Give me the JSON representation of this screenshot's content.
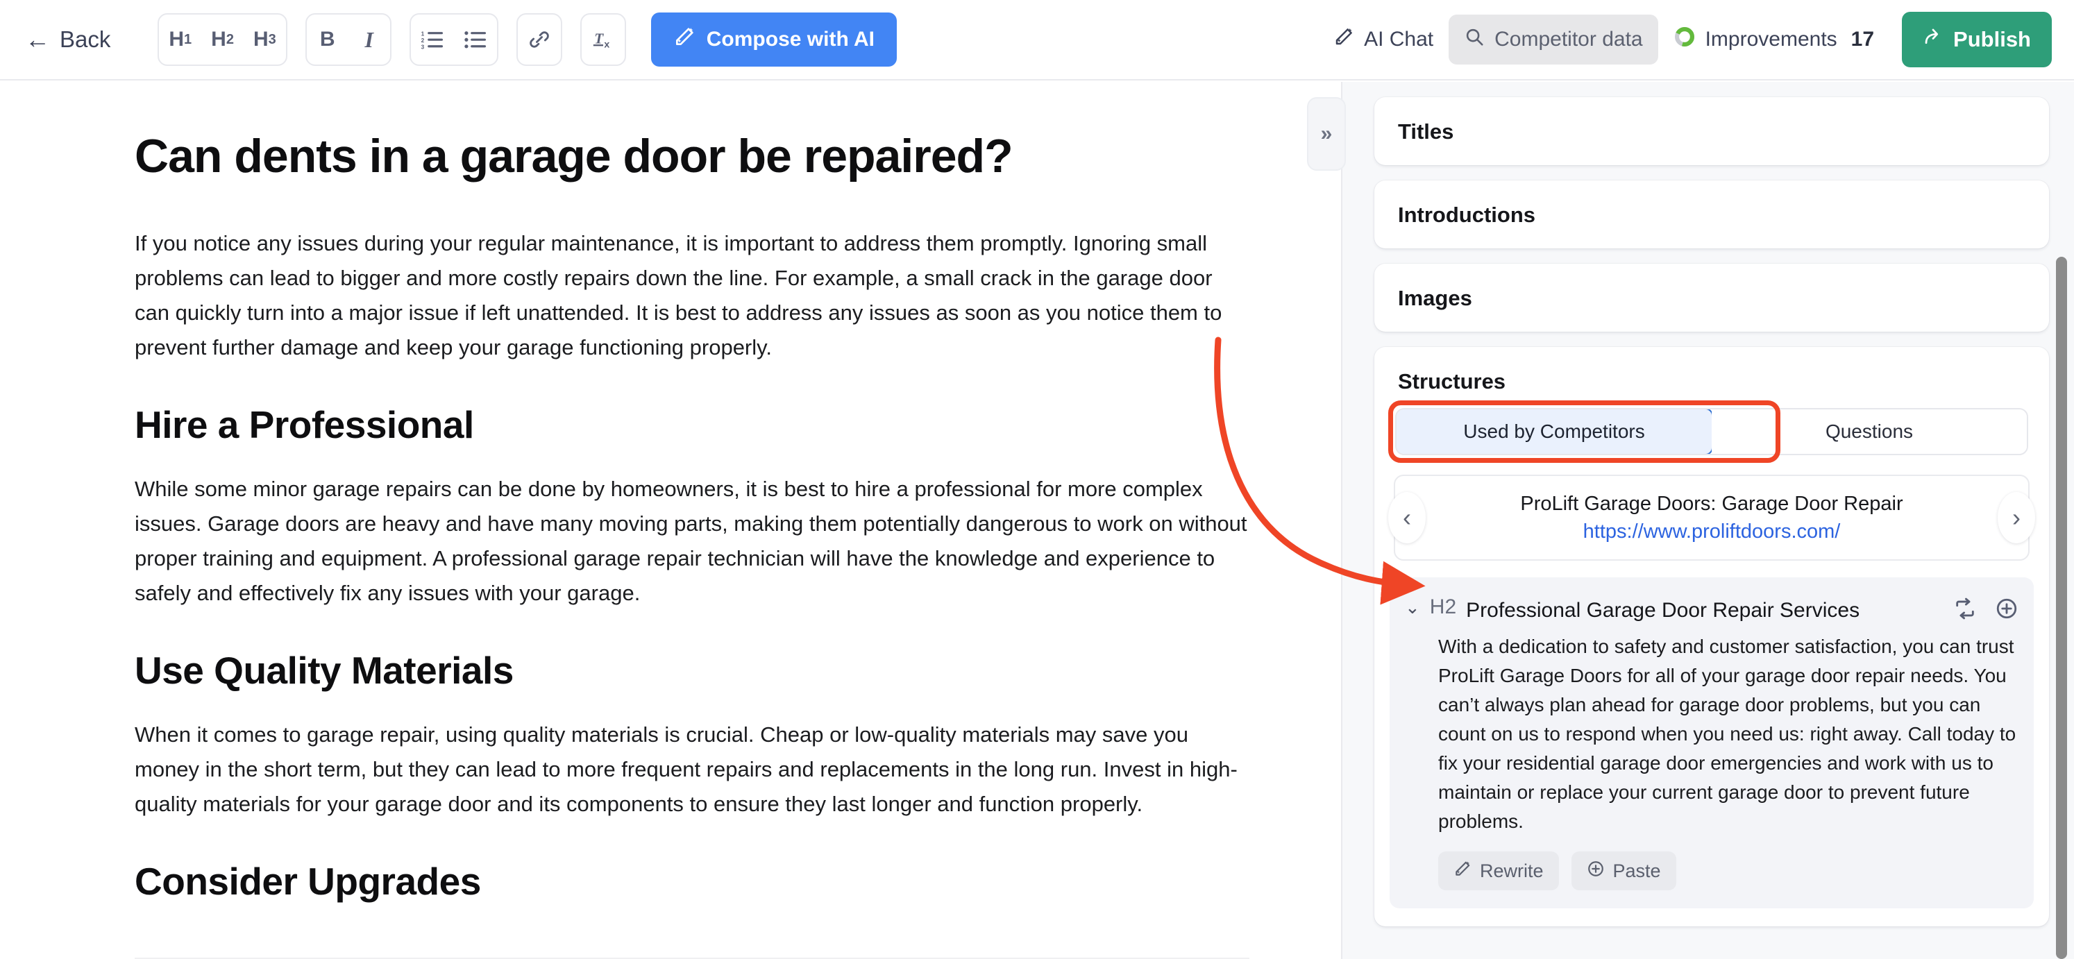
{
  "toolbar": {
    "back_label": "Back",
    "back_icon": "arrow-left-icon",
    "heading_buttons": [
      {
        "label": "H",
        "sub": "1",
        "name": "h1"
      },
      {
        "label": "H",
        "sub": "2",
        "name": "h2"
      },
      {
        "label": "H",
        "sub": "3",
        "name": "h3"
      }
    ],
    "format_buttons": [
      {
        "label": "B",
        "name": "bold"
      },
      {
        "label": "I",
        "name": "italic"
      }
    ],
    "list_buttons": [
      {
        "icon": "ordered-list-icon",
        "name": "ordered-list"
      },
      {
        "icon": "bullet-list-icon",
        "name": "bullet-list"
      }
    ],
    "link_button": {
      "icon": "link-icon",
      "name": "insert-link"
    },
    "clear_format_button": {
      "label": "Tx",
      "icon": "clear-format-icon",
      "name": "clear-formatting"
    },
    "compose_label": "Compose with AI",
    "compose_icon": "magic-wand-icon",
    "compose_color": "#4285f4",
    "ai_chat_label": "AI Chat",
    "ai_chat_icon": "magic-wand-icon",
    "competitor_data_label": "Competitor data",
    "competitor_data_icon": "search-icon",
    "improvements_label": "Improvements",
    "improvements_count": "17",
    "improvements_icon": "donut-progress-icon",
    "improvements_color": "#63ba3c",
    "publish_label": "Publish",
    "publish_icon": "share-arrow-icon",
    "publish_color": "#2e9e79"
  },
  "collapse_panel": {
    "icon": "chevron-double-right-icon",
    "label": "»"
  },
  "document": {
    "title": "Can dents in a garage door be repaired?",
    "blocks": [
      {
        "type": "paragraph",
        "text": "If you notice any issues during your regular maintenance, it is important to address them promptly. Ignoring small problems can lead to bigger and more costly repairs down the line. For example, a small crack in the garage door can quickly turn into a major issue if left unattended. It is best to address any issues as soon as you notice them to prevent further damage and keep your garage functioning properly."
      },
      {
        "type": "heading",
        "text": "Hire a Professional"
      },
      {
        "type": "paragraph",
        "text": "While some minor garage repairs can be done by homeowners, it is best to hire a professional for more complex issues. Garage doors are heavy and have many moving parts, making them potentially dangerous to work on without proper training and equipment. A professional garage repair technician will have the knowledge and experience to safely and effectively fix any issues with your garage."
      },
      {
        "type": "heading",
        "text": "Use Quality Materials"
      },
      {
        "type": "paragraph",
        "text": "When it comes to garage repair, using quality materials is crucial. Cheap or low-quality materials may save you money in the short term, but they can lead to more frequent repairs and replacements in the long run. Invest in high-quality materials for your garage door and its components to ensure they last longer and function properly."
      },
      {
        "type": "heading",
        "text": "Consider Upgrades"
      }
    ]
  },
  "panel": {
    "sections": [
      {
        "title": "Titles"
      },
      {
        "title": "Introductions"
      },
      {
        "title": "Images"
      }
    ],
    "structures": {
      "title": "Structures",
      "tabs": [
        {
          "label": "Used by Competitors",
          "active": true
        },
        {
          "label": "Questions",
          "active": false
        }
      ],
      "highlight_color": "#ef4526",
      "carousel": {
        "prev_icon": "chevron-left-icon",
        "next_icon": "chevron-right-icon",
        "competitor_name": "ProLift Garage Doors: Garage Door Repair",
        "competitor_url": "https://www.proliftdoors.com/"
      },
      "items": [
        {
          "caret_icon": "chevron-down-icon",
          "level": "H2",
          "heading": "Professional Garage Door Repair Services",
          "body": "With a dedication to safety and customer satisfaction, you can trust ProLift Garage Doors for all of your garage door repair needs. You can’t always plan ahead for garage door problems, but you can count on us to respond when you need us: right away. Call today to fix your residential garage door emergencies and work with us to maintain or replace your current garage door to prevent future problems.",
          "actions": [
            {
              "icon": "replace-swap-icon",
              "name": "replace"
            },
            {
              "icon": "plus-circle-icon",
              "name": "add"
            }
          ],
          "buttons": [
            {
              "label": "Rewrite",
              "icon": "magic-wand-icon"
            },
            {
              "label": "Paste",
              "icon": "plus-circle-icon"
            }
          ]
        }
      ]
    }
  }
}
